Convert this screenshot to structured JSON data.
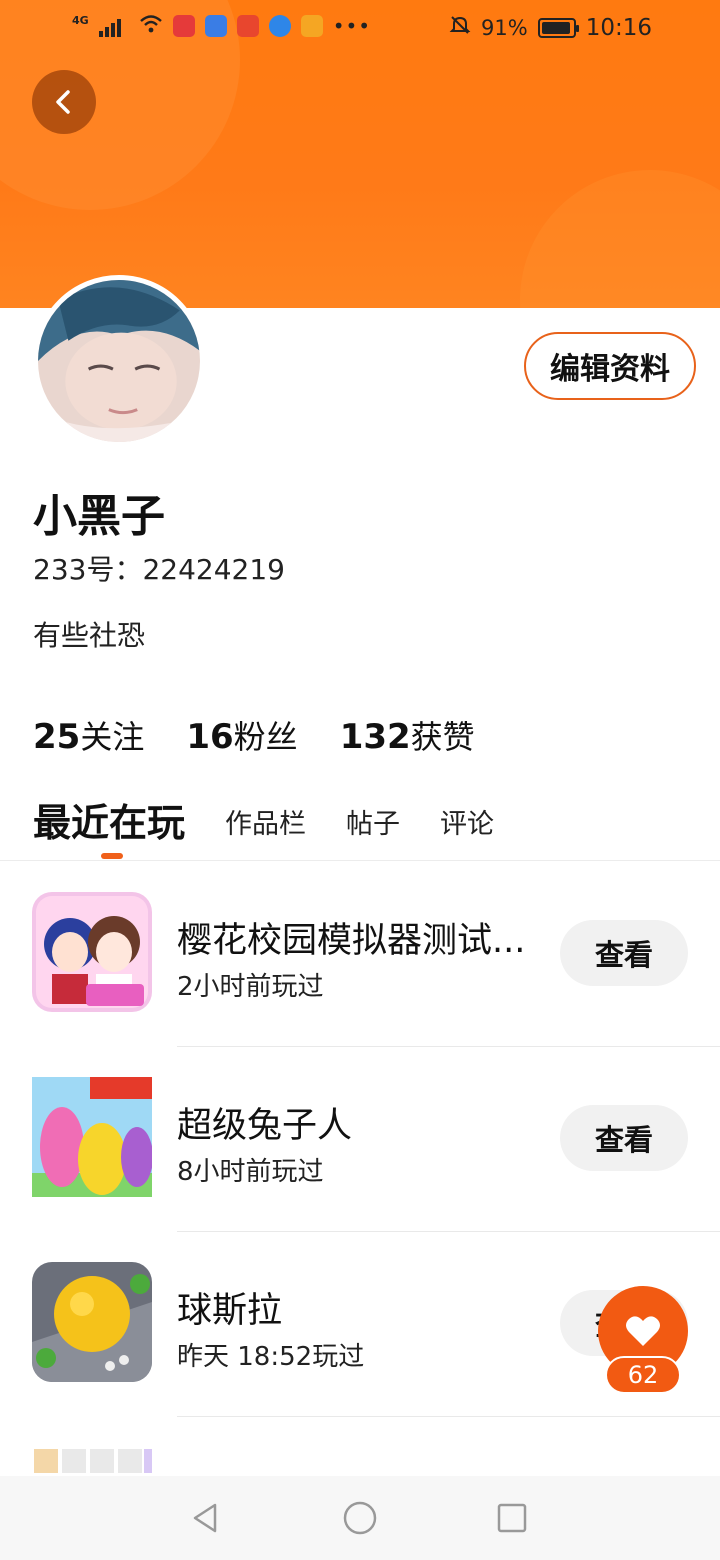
{
  "status_bar": {
    "network": "4G",
    "battery": "91%",
    "time": "10:16",
    "icons": [
      "signal-icon",
      "wifi-icon",
      "app-notification-icon",
      "music-icon",
      "app-icon",
      "browser-icon",
      "app-icon",
      "more-icon",
      "mute-icon",
      "battery-icon"
    ]
  },
  "profile": {
    "name": "小黑子",
    "id_text": "233号：22424219",
    "bio": "有些社恐",
    "edit_label": "编辑资料"
  },
  "stats": [
    {
      "value": "25",
      "label": "关注"
    },
    {
      "value": "16",
      "label": "粉丝"
    },
    {
      "value": "132",
      "label": "获赞"
    }
  ],
  "tabs": [
    {
      "label": "最近在玩",
      "active": true
    },
    {
      "label": "作品栏",
      "active": false
    },
    {
      "label": "帖子",
      "active": false
    },
    {
      "label": "评论",
      "active": false
    }
  ],
  "games": [
    {
      "title": "樱花校园模拟器测试...",
      "time": "2小时前玩过",
      "button": "查看",
      "icon_name": "sakura-school-thumb"
    },
    {
      "title": "超级兔子人",
      "time": "8小时前玩过",
      "button": "查看",
      "icon_name": "super-bunny-thumb"
    },
    {
      "title": "球斯拉",
      "time": "昨天 18:52玩过",
      "button": "查看",
      "icon_name": "ball-game-thumb"
    },
    {
      "title": "",
      "time": "",
      "button": "",
      "icon_name": "word-puzzle-thumb"
    }
  ],
  "like_fab": {
    "count": "62"
  },
  "colors": {
    "accent": "#f25a12",
    "header": "#ff7a10",
    "button_bg": "#f1f1f1"
  }
}
